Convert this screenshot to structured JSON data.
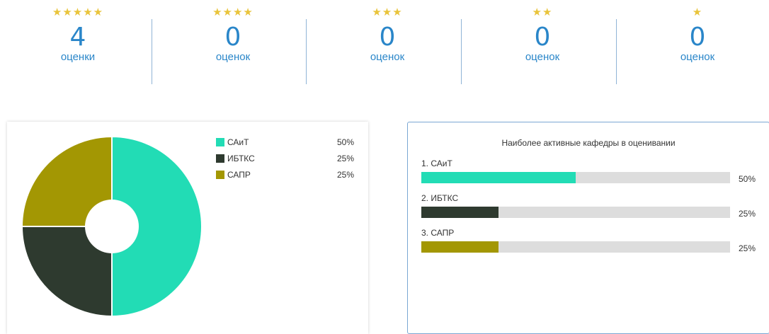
{
  "ratings": [
    {
      "stars": "★★★★★",
      "count": "4",
      "label": "оценки"
    },
    {
      "stars": "★★★★",
      "count": "0",
      "label": "оценок"
    },
    {
      "stars": "★★★",
      "count": "0",
      "label": "оценок"
    },
    {
      "stars": "★★",
      "count": "0",
      "label": "оценок"
    },
    {
      "stars": "★",
      "count": "0",
      "label": "оценок"
    }
  ],
  "colors": {
    "accent_blue": "#2a86c9",
    "star": "#e9c43b",
    "sait": "#22dcb5",
    "ibtks": "#2e3a2f",
    "sapr": "#a39703",
    "track": "#dddddd"
  },
  "pie_legend": [
    {
      "label": "САиТ",
      "value": "50%",
      "color": "#22dcb5"
    },
    {
      "label": "ИБТКС",
      "value": "25%",
      "color": "#2e3a2f"
    },
    {
      "label": "САПР",
      "value": "25%",
      "color": "#a39703"
    }
  ],
  "chart_data": {
    "type": "pie",
    "categories": [
      "САиТ",
      "ИБТКС",
      "САПР"
    ],
    "values": [
      50,
      25,
      25
    ],
    "colors": [
      "#22dcb5",
      "#2e3a2f",
      "#a39703"
    ],
    "donut": true,
    "legend": "right"
  },
  "bars": {
    "title": "Наиболее активные кафедры в оценивании",
    "items": [
      {
        "label": "1. САиТ",
        "percent": 50,
        "percent_text": "50%",
        "color": "#22dcb5"
      },
      {
        "label": "2. ИБТКС",
        "percent": 25,
        "percent_text": "25%",
        "color": "#2e3a2f"
      },
      {
        "label": "3. САПР",
        "percent": 25,
        "percent_text": "25%",
        "color": "#a39703"
      }
    ]
  }
}
